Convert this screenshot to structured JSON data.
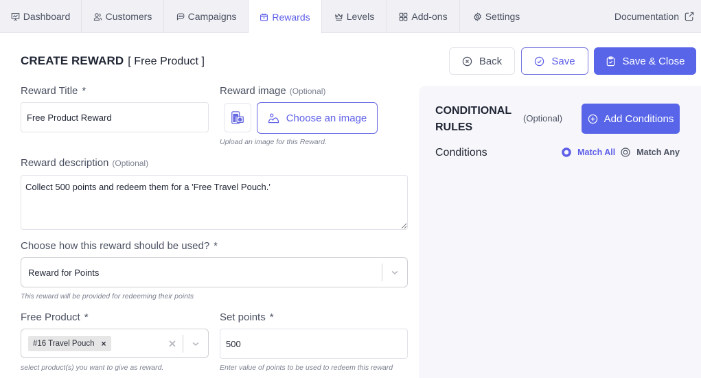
{
  "nav": {
    "tabs": [
      {
        "label": "Dashboard",
        "icon": "presentation-chart-icon",
        "active": false
      },
      {
        "label": "Customers",
        "icon": "users-icon",
        "active": false
      },
      {
        "label": "Campaigns",
        "icon": "chat-bubbles-icon",
        "active": false
      },
      {
        "label": "Rewards",
        "icon": "gift-box-icon",
        "active": true
      },
      {
        "label": "Levels",
        "icon": "crown-icon",
        "active": false
      },
      {
        "label": "Add-ons",
        "icon": "grid-icon",
        "active": false
      },
      {
        "label": "Settings",
        "icon": "gear-icon",
        "active": false
      }
    ],
    "documentation": "Documentation"
  },
  "header": {
    "title": "CREATE REWARD",
    "subtitle": "[ Free Product ]",
    "back_label": "Back",
    "save_label": "Save",
    "save_close_label": "Save & Close"
  },
  "form": {
    "reward_title": {
      "label": "Reward Title",
      "required": "*",
      "value": "Free Product Reward"
    },
    "reward_image": {
      "label": "Reward image",
      "optional": "(Optional)",
      "button_label": "Choose an image",
      "help": "Upload an image for this Reward."
    },
    "description": {
      "label": "Reward description",
      "optional": "(Optional)",
      "value": "Collect 500 points and redeem them for a 'Free Travel Pouch.'"
    },
    "usage": {
      "label": "Choose how this reward should be used?",
      "required": "*",
      "selected": "Reward for Points",
      "help": "This reward will be provided for redeeming their points"
    },
    "free_product": {
      "label": "Free Product",
      "required": "*",
      "tags": [
        "#16 Travel Pouch"
      ],
      "tag_remove": "×",
      "help": "select product(s) you want to give as reward."
    },
    "points": {
      "label": "Set points",
      "required": "*",
      "value": "500",
      "help": "Enter value of points to be used to redeem this reward"
    }
  },
  "conditions": {
    "title": "CONDITIONAL RULES",
    "optional": "(Optional)",
    "add_label": "Add Conditions",
    "label": "Conditions",
    "match_options": [
      "Match All",
      "Match Any"
    ],
    "selected_match": "Match All"
  },
  "colors": {
    "accent": "#5d5ee8",
    "primary_button": "#5865e8",
    "nav_bg": "#f1f1f5",
    "panel_bg": "#f7f7fb"
  }
}
